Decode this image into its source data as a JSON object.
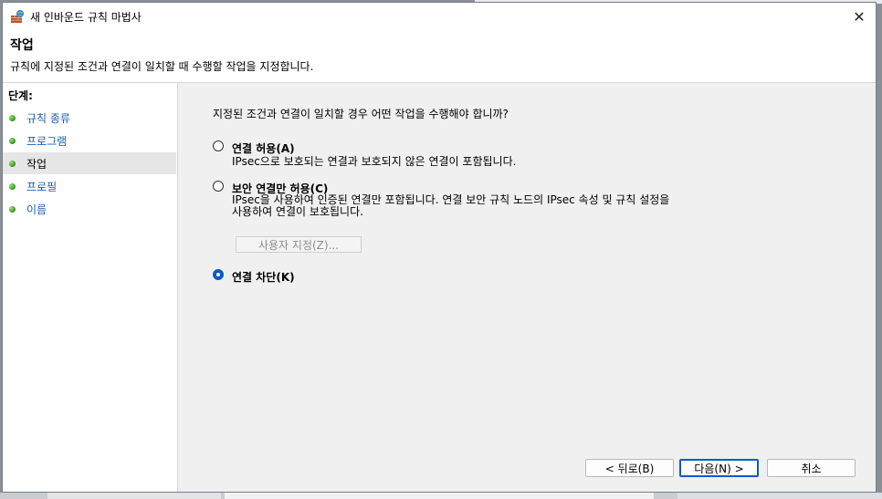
{
  "window": {
    "title": "새 인바운드 규칙 마법사",
    "close_glyph": "✕"
  },
  "header": {
    "title": "작업",
    "description": "규칙에 지정된 조건과 연결이 일치할 때 수행할 작업을 지정합니다."
  },
  "steps": {
    "title": "단계:",
    "items": [
      {
        "label": "규칙 종류",
        "current": false
      },
      {
        "label": "프로그램",
        "current": false
      },
      {
        "label": "작업",
        "current": true
      },
      {
        "label": "프로필",
        "current": false
      },
      {
        "label": "이름",
        "current": false
      }
    ]
  },
  "content": {
    "question": "지정된 조건과 연결이 일치할 경우 어떤 작업을 수행해야 합니까?",
    "options": [
      {
        "label": "연결 허용(A)",
        "description": "IPsec으로 보호되는 연결과 보호되지 않은 연결이 포함됩니다.",
        "checked": false
      },
      {
        "label": "보안 연결만 허용(C)",
        "description_line1": "IPsec을 사용하여 인증된 연결만 포함됩니다. 연결 보안 규칙 노드의 IPsec 속성 및 규칙 설정을",
        "description_line2": "사용하여 연결이 보호됩니다.",
        "checked": false
      },
      {
        "label": "연결 차단(K)",
        "checked": true
      }
    ],
    "customize_label": "사용자 지정(Z)..."
  },
  "buttons": {
    "back": "< 뒤로(B)",
    "next": "다음(N) >",
    "cancel": "취소"
  },
  "colors": {
    "accent": "#0a5bc4",
    "link": "#1a5fb4",
    "step_dot": "#2f8f1b"
  }
}
